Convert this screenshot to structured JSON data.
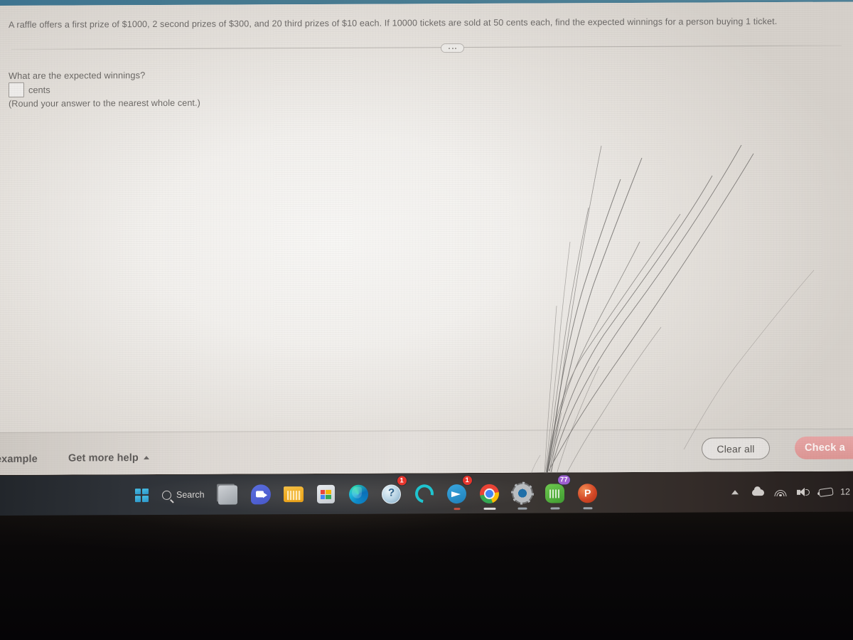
{
  "question": {
    "stem": "A raffle offers a first prize of $1000, 2 second prizes of $300, and 20 third prizes of $10 each. If 10000 tickets are sold at 50 cents each, find the expected winnings for a person buying 1 ticket.",
    "more_options_label": "•••",
    "prompt": "What are the expected winnings?",
    "answer_value": "",
    "answer_placeholder": "",
    "answer_unit": "cents",
    "note": "(Round your answer to the nearest whole cent.)"
  },
  "footer": {
    "view_example_label": "example",
    "get_more_help_label": "Get more help",
    "get_more_help_caret": "caret-up-icon",
    "clear_all_label": "Clear all",
    "check_answer_label": "Check a",
    "check_answer_color": "#e09a9a",
    "clear_all_border_color": "#8f8b87"
  },
  "taskbar": {
    "start_label": "Start",
    "search_label": "Search",
    "apps": [
      {
        "name": "task-view",
        "label": "Task View",
        "badge": "",
        "running": false
      },
      {
        "name": "microsoft-teams",
        "label": "Microsoft Teams",
        "badge": "",
        "running": false
      },
      {
        "name": "file-explorer",
        "label": "File Explorer",
        "badge": "",
        "running": false
      },
      {
        "name": "microsoft-store",
        "label": "Microsoft Store",
        "badge": "",
        "running": false
      },
      {
        "name": "microsoft-edge",
        "label": "Microsoft Edge",
        "badge": "",
        "running": false
      },
      {
        "name": "get-help",
        "label": "Get Help",
        "badge": "1",
        "running": false
      },
      {
        "name": "copilot",
        "label": "Copilot",
        "badge": "",
        "running": false
      },
      {
        "name": "telegram",
        "label": "Telegram",
        "badge": "1",
        "running": true
      },
      {
        "name": "google-chrome",
        "label": "Google Chrome",
        "badge": "",
        "running": true
      },
      {
        "name": "settings",
        "label": "Settings",
        "badge": "",
        "running": true
      },
      {
        "name": "whatsapp",
        "label": "WhatsApp",
        "badge": "77",
        "running": true
      },
      {
        "name": "powerpoint",
        "label": "PowerPoint",
        "badge": "",
        "running": true
      }
    ],
    "tray": {
      "hidden_icons": "chevron-up-icon",
      "onedrive": "cloud-icon",
      "network": "wifi-icon",
      "volume": "speaker-icon",
      "battery": "battery-icon",
      "clock": "12"
    }
  },
  "colors": {
    "top_bezel": "#46798f",
    "page_light": "#f5f4f2",
    "page_edge": "#d5d1cc",
    "taskbar": "#2f3339",
    "text": "#6d6a68"
  }
}
